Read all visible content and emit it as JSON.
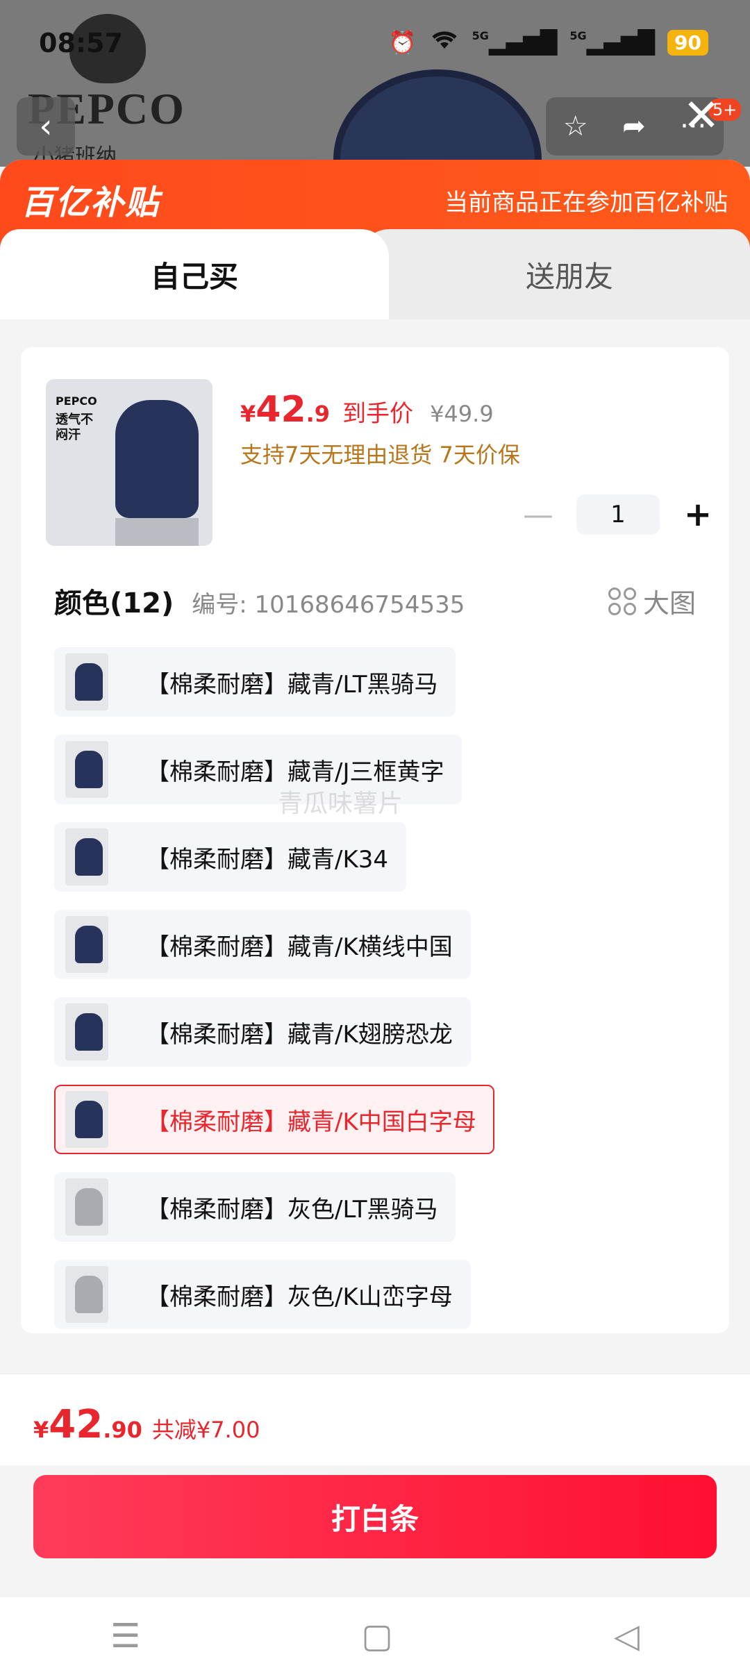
{
  "status_bar": {
    "time": "08:57",
    "battery": "90",
    "signal1": "5G",
    "signal2": "5G"
  },
  "background": {
    "brand": "PEPCO",
    "brand_sub": "小猪班纳"
  },
  "top_nav": {
    "badge": "5+"
  },
  "promo": {
    "logo": "百亿补贴",
    "text": "当前商品正在参加百亿补贴"
  },
  "tabs": [
    {
      "label": "自己买"
    },
    {
      "label": "送朋友"
    }
  ],
  "product": {
    "image_brand": "PEPCO",
    "image_slogan": "透气不闷汗",
    "price_symbol": "¥",
    "price_int": "42",
    "price_dec": ".9",
    "price_label": "到手价",
    "orig_price": "¥49.9",
    "guarantee": "支持7天无理由退货 7天价保",
    "quantity": "1"
  },
  "colors": {
    "title": "颜色(12)",
    "code": "编号: 10168646754535",
    "big_image_label": "大图",
    "items": [
      {
        "label": "【棉柔耐磨】藏青/LT黑骑马"
      },
      {
        "label": "【棉柔耐磨】藏青/J三框黄字"
      },
      {
        "label": "【棉柔耐磨】藏青/K34"
      },
      {
        "label": "【棉柔耐磨】藏青/K横线中国"
      },
      {
        "label": "【棉柔耐磨】藏青/K翅膀恐龙"
      },
      {
        "label": "【棉柔耐磨】藏青/K中国白字母"
      },
      {
        "label": "【棉柔耐磨】灰色/LT黑骑马"
      },
      {
        "label": "【棉柔耐磨】灰色/K山峦字母"
      }
    ],
    "selected_index": 5
  },
  "watermark": "青瓜味薯片",
  "bottom": {
    "price_symbol": "¥",
    "price_int": "42",
    "price_dec": ".90",
    "savings": "共减¥7.00",
    "buy_label": "打白条"
  },
  "colors_hex": {
    "accent_red": "#e8262e",
    "promo_orange": "#ff4a1c"
  }
}
